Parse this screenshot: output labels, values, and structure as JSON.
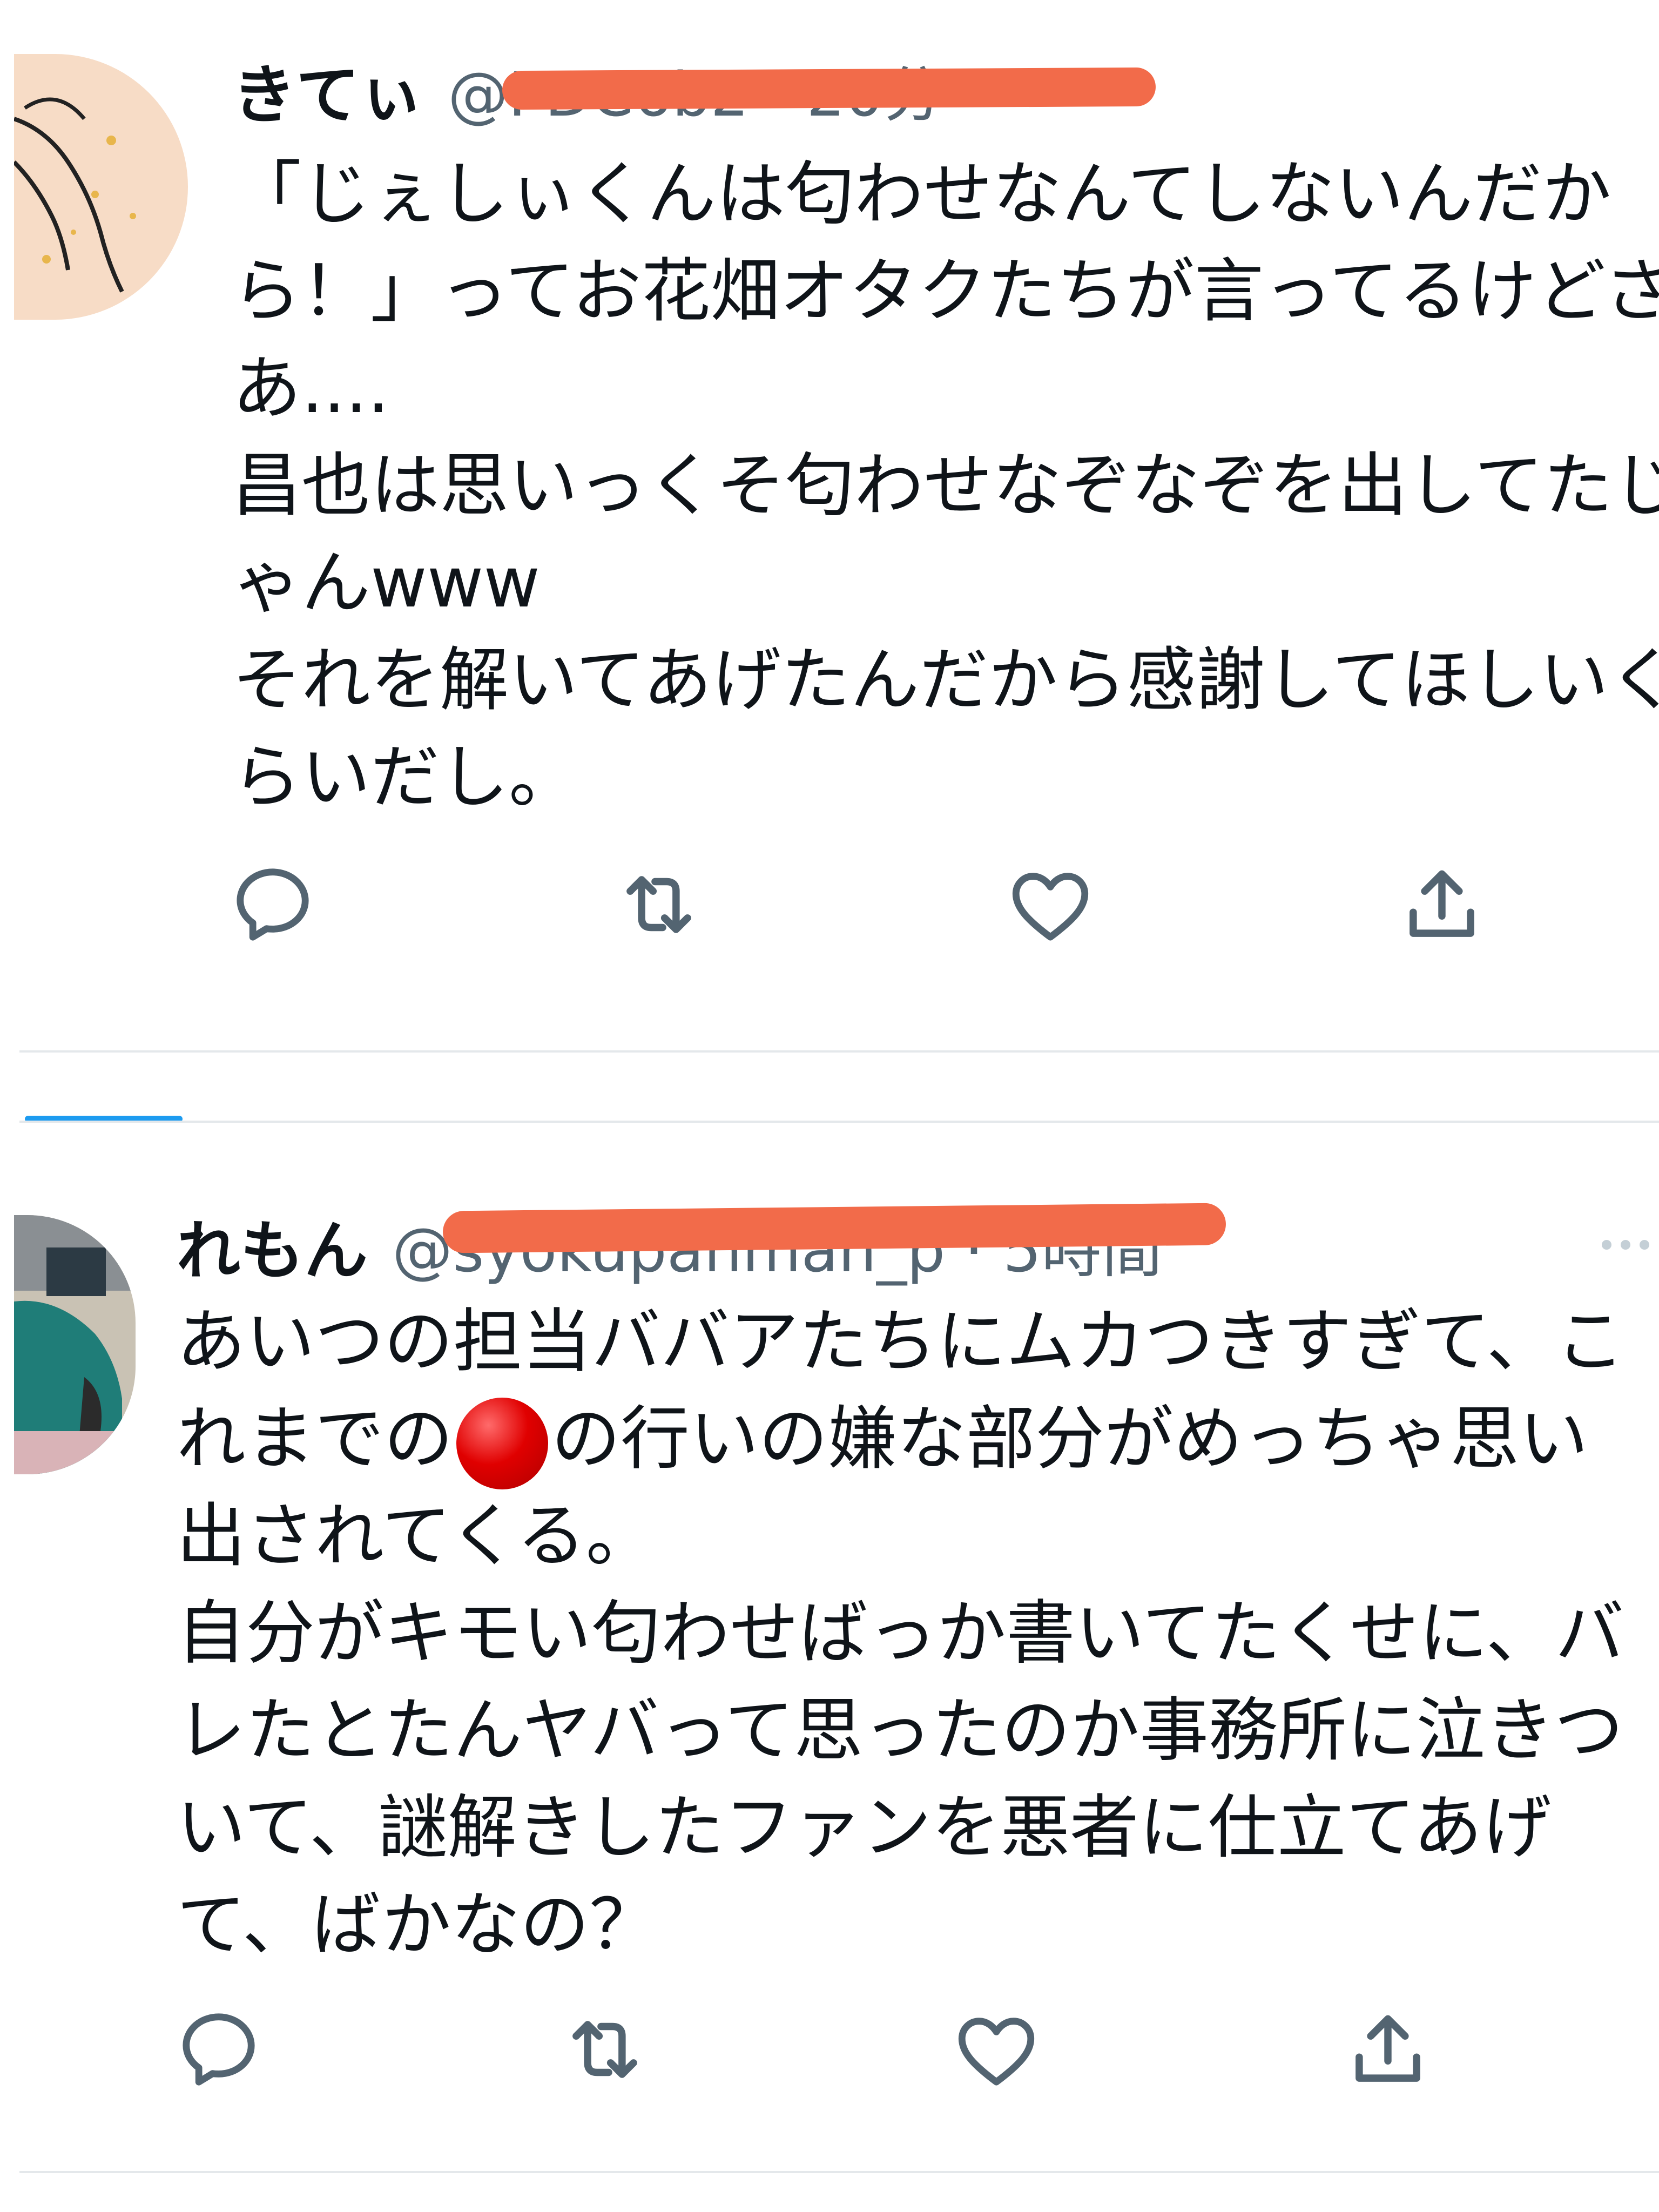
{
  "tweets": [
    {
      "display_name": "きてぃ",
      "handle_meta": "@PDC6b2 · 20分",
      "text_lines": [
        "「じぇしぃくんは匂わせなんてしないんだか",
        "ら！」ってお花畑オタクたちが言ってるけどさ",
        "あ....",
        "昌也は思いっくそ匂わせなぞなぞを出してたじ",
        "ゃんwww",
        "それを解いてあげたんだから感謝してほしいく",
        "らいだし。"
      ]
    },
    {
      "display_name": "れもん",
      "handle_meta": "@syokupanman_p · 5時間",
      "text_lines_before_dot": [
        "あいつの担当ババアたちにムカつきすぎて、こ"
      ],
      "line2_prefix": "れまでの",
      "line2_suffix": "の行いの嫌な部分がめっちゃ思い",
      "text_lines_after_dot": [
        "出されてくる。",
        "自分がキモい匂わせばっか書いてたくせに、バ",
        "レたとたんヤバって思ったのか事務所に泣きつ",
        "いて、謎解きしたファンを悪者に仕立てあげ",
        "て、ばかなの？"
      ]
    }
  ],
  "icons": {
    "reply": "reply-icon",
    "retweet": "retweet-icon",
    "like": "heart-icon",
    "share": "share-icon",
    "more": "more-icon",
    "red_circle": "red-circle-emoji"
  },
  "colors": {
    "text": "#0f1419",
    "secondary": "#536471",
    "redaction": "#f26b4a",
    "divider": "#e4e8eb",
    "accent": "#1d9bf0",
    "icon": "#536471"
  }
}
